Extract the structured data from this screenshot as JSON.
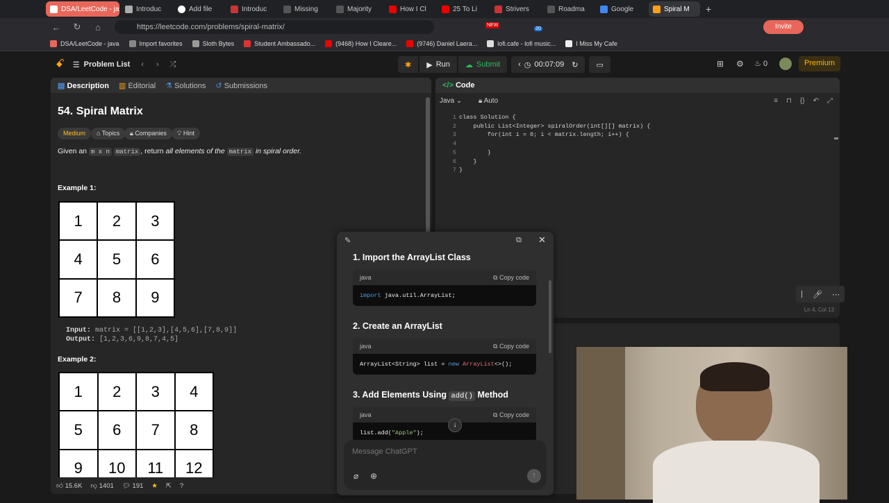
{
  "tabs": [
    {
      "label": "DSA/LeetCode - java",
      "style": "red"
    },
    {
      "label": "Introduc"
    },
    {
      "label": "Add file"
    },
    {
      "label": "Introduc"
    },
    {
      "label": "Missing"
    },
    {
      "label": "Majority"
    },
    {
      "label": "How I Cl"
    },
    {
      "label": "25 To Li"
    },
    {
      "label": "Strivers"
    },
    {
      "label": "Roadma"
    },
    {
      "label": "Google"
    },
    {
      "label": "Spiral M",
      "style": "current"
    }
  ],
  "address": {
    "url": "https://leetcode.com/problems/spiral-matrix/",
    "invite": "Invite",
    "new_badge": "NEW",
    "ext_count": "20"
  },
  "bookmarks": [
    "DSA/LeetCode - java",
    "Import favorites",
    "Sloth Bytes",
    "Student Ambassado...",
    "(9468) How I Cleare...",
    "(9746) Daniel Laera...",
    "lofi.cafe - lofi music...",
    "I Miss My Cafe"
  ],
  "lc": {
    "problem_list": "Problem List",
    "run": "Run",
    "submit": "Submit",
    "timer": "00:07:09",
    "streak": "0",
    "premium": "Premium"
  },
  "left": {
    "tabs": [
      "Description",
      "Editorial",
      "Solutions",
      "Submissions"
    ],
    "title": "54. Spiral Matrix",
    "difficulty": "Medium",
    "chips": [
      "Topics",
      "Companies",
      "Hint"
    ],
    "desc_pre": "Given an",
    "desc_code1": "m x n",
    "desc_code2": "matrix",
    "desc_mid": ", return",
    "desc_em": "all elements of the",
    "desc_code3": "matrix",
    "desc_post": "in spiral order.",
    "ex1_title": "Example 1:",
    "ex1_grid": [
      "1",
      "2",
      "3",
      "4",
      "5",
      "6",
      "7",
      "8",
      "9"
    ],
    "ex1_input_label": "Input:",
    "ex1_input": "matrix = [[1,2,3],[4,5,6],[7,8,9]]",
    "ex1_output_label": "Output:",
    "ex1_output": "[1,2,3,6,9,8,7,4,5]",
    "ex2_title": "Example 2:",
    "ex2_grid": [
      "1",
      "2",
      "3",
      "4",
      "5",
      "6",
      "7",
      "8",
      "9",
      "10",
      "11",
      "12"
    ],
    "likes": "15.6K",
    "dislikes": "1401",
    "comments": "191"
  },
  "code": {
    "tab": "Code",
    "lang": "Java",
    "mode": "Auto",
    "status": "Ln 4, Col 13",
    "lines": [
      "class Solution {",
      "    public List<Integer> spiralOrder(int[][] matrix) {",
      "        for(int i = 0; i < matrix.length; i++) {",
      "",
      "        }",
      "    }",
      "}"
    ]
  },
  "chat": {
    "h1": "1. Import the ArrayList Class",
    "h2": "2. Create an ArrayList",
    "h3_pre": "3. Add Elements Using",
    "h3_code": "add()",
    "h3_post": "Method",
    "lang": "java",
    "copy": "Copy code",
    "code1_kw": "import",
    "code1_rest": "java.util.ArrayList;",
    "code2_a": "ArrayList<String> list = ",
    "code2_kw": "new",
    "code2_ty": "ArrayList",
    "code2_end": "<>();",
    "code3_a": "list.add(",
    "code3_str": "\"Apple\"",
    "code3_end": ");",
    "placeholder": "Message ChatGPT"
  }
}
